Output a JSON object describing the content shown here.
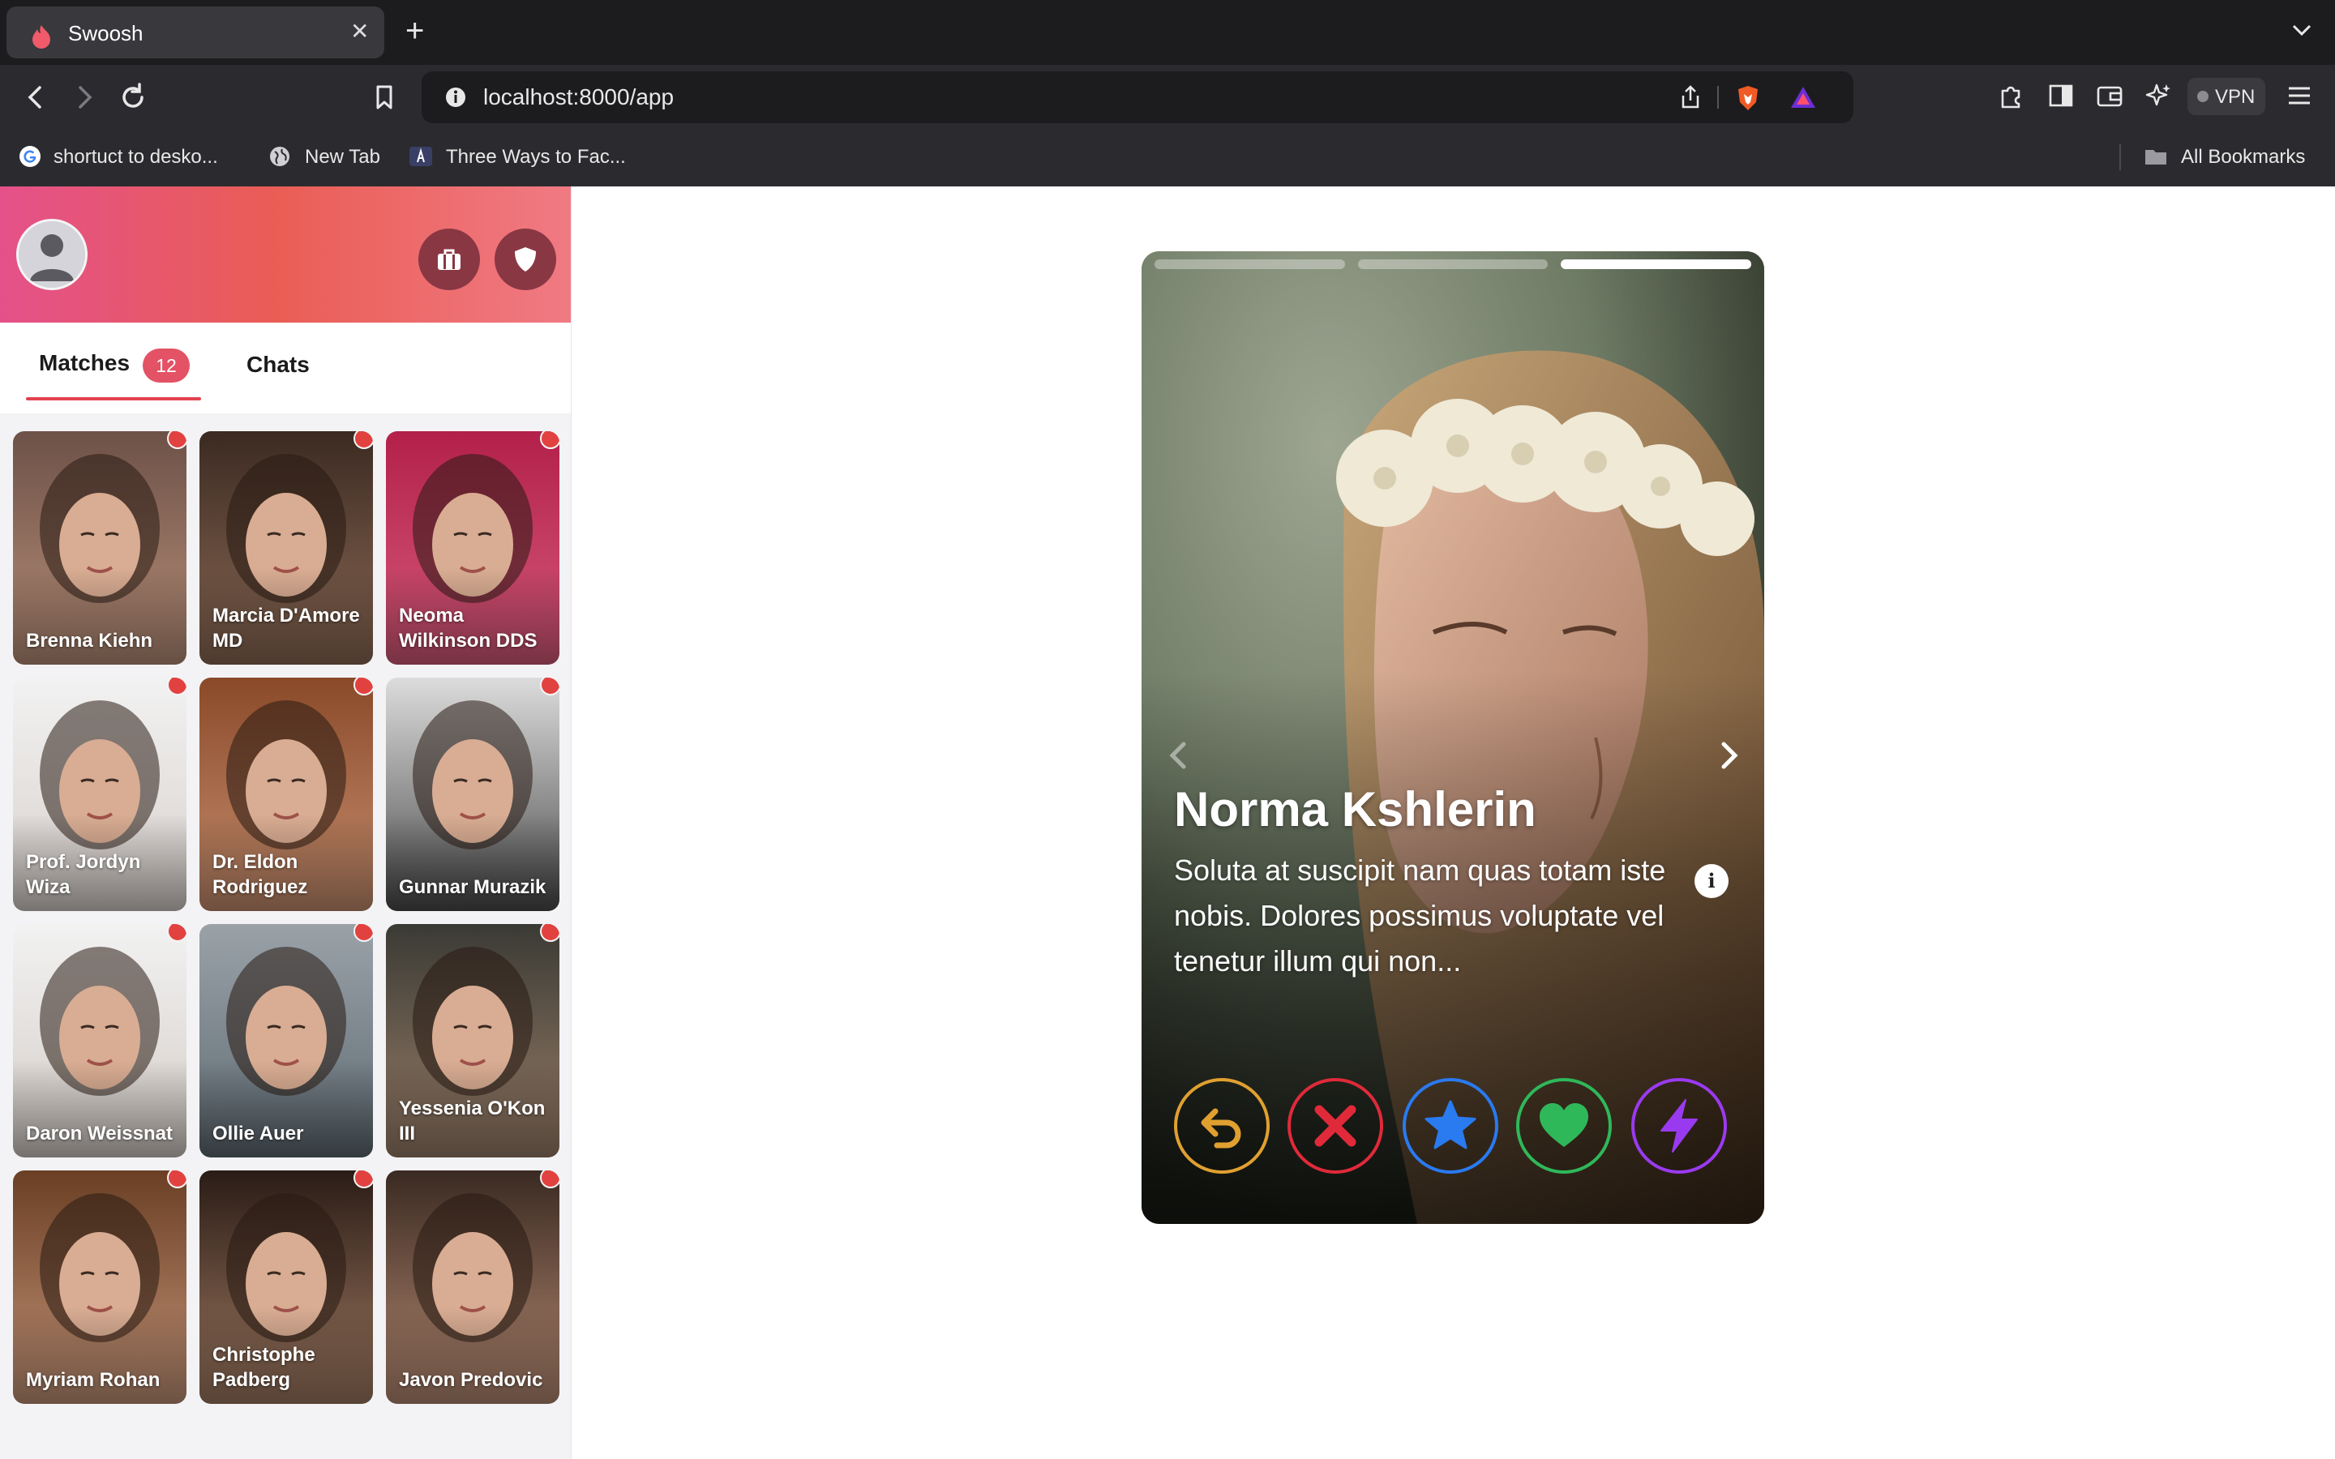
{
  "browser": {
    "tab_title": "Swoosh",
    "url": "localhost:8000/app",
    "vpn_label": "VPN",
    "bookmarks": [
      {
        "label": "shortuct to desko...",
        "icon": "google-icon"
      },
      {
        "label": "New Tab",
        "icon": "globe-icon"
      },
      {
        "label": "Three Ways to Fac...",
        "icon": "site-icon"
      }
    ],
    "all_bookmarks_label": "All Bookmarks"
  },
  "sidebar": {
    "tabs": {
      "matches_label": "Matches",
      "matches_count": "12",
      "chats_label": "Chats"
    },
    "matches": [
      {
        "name": "Brenna Kiehn",
        "photo": [
          "#6d5148",
          "#b88f78"
        ]
      },
      {
        "name": "Marcia D'Amore MD",
        "photo": [
          "#3b2a22",
          "#8c6a55"
        ]
      },
      {
        "name": "Neoma Wilkinson DDS",
        "photo": [
          "#b3204a",
          "#d65a7a"
        ]
      },
      {
        "name": "Prof. Jordyn Wiza",
        "photo": [
          "#f2f2f2",
          "#d8d0cb"
        ]
      },
      {
        "name": "Dr. Eldon Rodriguez",
        "photo": [
          "#8a4a2a",
          "#c88f6f"
        ]
      },
      {
        "name": "Gunnar Murazik",
        "photo": [
          "#dcdcdc",
          "#4a4a4a"
        ]
      },
      {
        "name": "Daron Weissnat",
        "photo": [
          "#f2f2f2",
          "#d4ccc6"
        ]
      },
      {
        "name": "Ollie Auer",
        "photo": [
          "#9aa2a8",
          "#5e6a72"
        ]
      },
      {
        "name": "Yessenia O'Kon III",
        "photo": [
          "#3a3a34",
          "#9a7f6a"
        ]
      },
      {
        "name": "Myriam Rohan",
        "photo": [
          "#6a3f24",
          "#c49478"
        ]
      },
      {
        "name": "Christophe Padberg",
        "photo": [
          "#2a1c16",
          "#a07a62"
        ]
      },
      {
        "name": "Javon Predovic",
        "photo": [
          "#3a2a22",
          "#b58a72"
        ]
      }
    ]
  },
  "profile": {
    "name": "Norma Kshlerin",
    "bio": "Soluta at suscipit nam quas totam iste nobis. Dolores possimus voluptate vel tenetur illum qui non...",
    "photo_count": 3,
    "active_photo": 3,
    "actions": [
      {
        "name": "rewind-button",
        "icon": "undo-icon",
        "color": "#e0a030"
      },
      {
        "name": "nope-button",
        "icon": "x-icon",
        "color": "#e02a3a"
      },
      {
        "name": "super-like-button",
        "icon": "star-icon",
        "color": "#2a7af0"
      },
      {
        "name": "like-button",
        "icon": "heart-icon",
        "color": "#2fb85a"
      },
      {
        "name": "boost-button",
        "icon": "bolt-icon",
        "color": "#9a3af0"
      }
    ]
  },
  "colors": {
    "brand_gradient": [
      "#e4518a",
      "#ea5d55",
      "#f07a83"
    ],
    "badge": "#e35265",
    "online_dot": "#e2423f"
  }
}
